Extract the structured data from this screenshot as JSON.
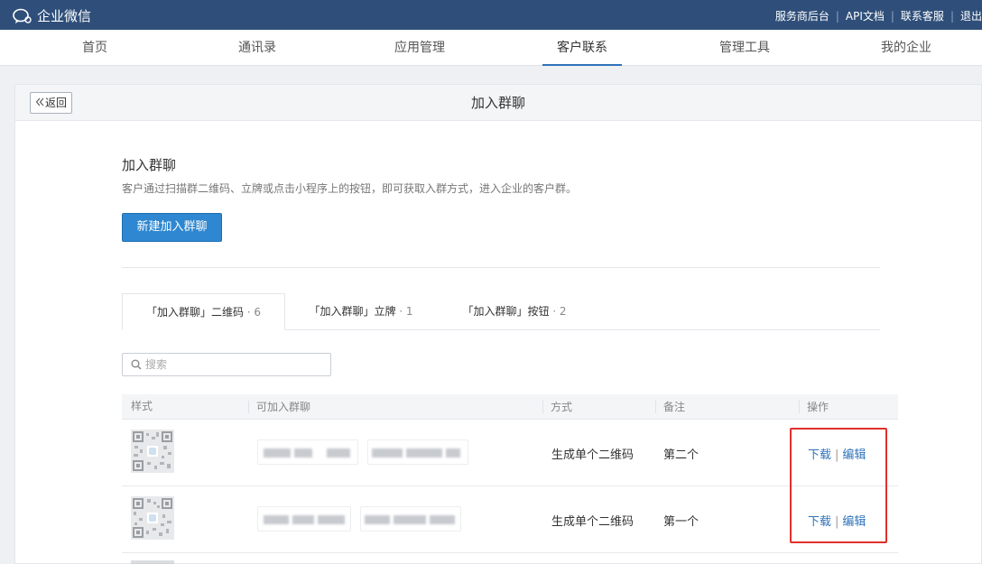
{
  "brand": {
    "name": "企业微信",
    "icon": "wecom-logo-icon"
  },
  "top_links": [
    "服务商后台",
    "API文档",
    "联系客服",
    "退出"
  ],
  "nav": {
    "tabs": [
      "首页",
      "通讯录",
      "应用管理",
      "客户联系",
      "管理工具",
      "我的企业"
    ],
    "active": "客户联系"
  },
  "panel": {
    "back_label": "返回",
    "title": "加入群聊"
  },
  "section": {
    "title": "加入群聊",
    "desc": "客户通过扫描群二维码、立牌或点击小程序上的按钮，即可获取入群方式，进入企业的客户群。",
    "new_button": "新建加入群聊"
  },
  "tabs": [
    {
      "label": "「加入群聊」二维码",
      "count": "· 6"
    },
    {
      "label": "「加入群聊」立牌",
      "count": "· 1"
    },
    {
      "label": "「加入群聊」按钮",
      "count": "· 2"
    }
  ],
  "search": {
    "placeholder": "搜索",
    "value": ""
  },
  "table": {
    "headers": [
      "样式",
      "可加入群聊",
      "方式",
      "备注",
      "操作"
    ],
    "rows": [
      {
        "method": "生成单个二维码",
        "note": "第二个",
        "ops": [
          "下载",
          "编辑"
        ]
      },
      {
        "method": "生成单个二维码",
        "note": "第一个",
        "ops": [
          "下载",
          "编辑"
        ]
      }
    ]
  },
  "colors": {
    "topbar": "#2f4f7a",
    "accent": "#2f73b8",
    "primary_button": "#2e87d0",
    "highlight": "#e0302d"
  }
}
